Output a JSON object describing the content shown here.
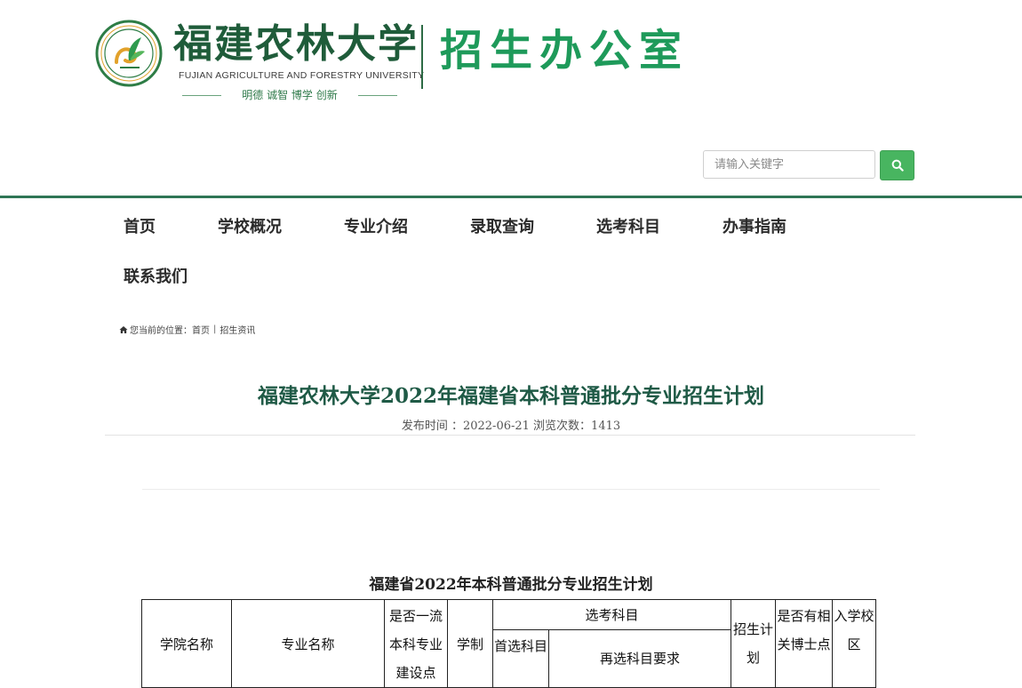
{
  "header": {
    "university_name_cn": "福建农林大学",
    "university_name_en": "FUJIAN AGRICULTURE AND FORESTRY UNIVERSITY",
    "motto": "明德 诚智 博学 创新",
    "office_name": "招生办公室",
    "emblem_icon": "university-seal",
    "brand_green": "#1e9a5a"
  },
  "search": {
    "placeholder": "请输入关键字",
    "value": "",
    "button_icon": "search-icon",
    "button_color": "#48b560"
  },
  "nav": {
    "items": [
      {
        "label": "首页"
      },
      {
        "label": "学校概况"
      },
      {
        "label": "专业介绍"
      },
      {
        "label": "录取查询"
      },
      {
        "label": "选考科目"
      },
      {
        "label": "办事指南"
      },
      {
        "label": "联系我们"
      }
    ]
  },
  "breadcrumb": {
    "home_icon": "home-icon",
    "prefix": "您当前的位置：",
    "home": "首页",
    "separator": "|",
    "current": "招生资讯"
  },
  "article": {
    "title": "福建农林大学2022年福建省本科普通批分专业招生计划",
    "meta": "发布时间 ：2022-06-21 浏览次数：1413"
  },
  "plan_table": {
    "title": "福建省2022年本科普通批分专业招生计划",
    "headers": {
      "college": "学院名称",
      "major": "专业名称",
      "first_class": "是否一流本科专业建设点",
      "duration": "学制",
      "subjects": "选考科目",
      "first_subject": "首选科目",
      "reselect": "再选科目要求",
      "plan": "招生计划",
      "doctoral": "是否有相关博士点",
      "campus": "入学校区"
    }
  }
}
